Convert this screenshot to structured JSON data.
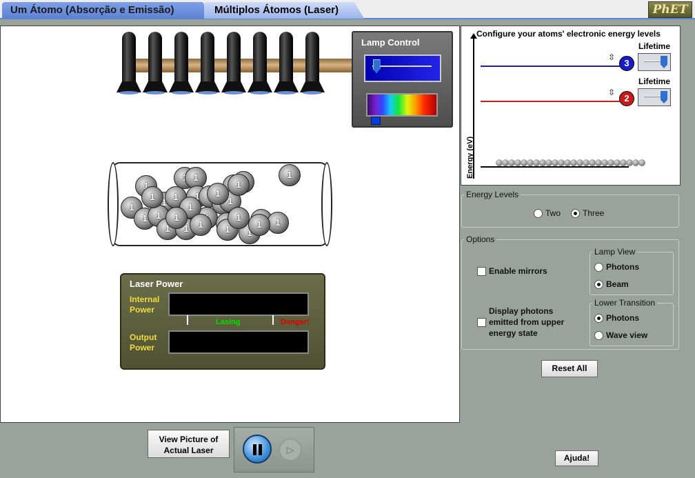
{
  "tabs": [
    {
      "label": "Um Átomo (Absorção e Emissão)",
      "active": false
    },
    {
      "label": "Múltiplos Átomos (Laser)",
      "active": true
    }
  ],
  "logo": "PhET",
  "lamp_control": {
    "title": "Lamp Control",
    "lamp_count": 8,
    "intensity_fraction": 0.05
  },
  "tube": {
    "atom_label": "1",
    "atom_count": 32
  },
  "laser_power": {
    "title": "Laser Power",
    "internal_label_1": "Internal",
    "internal_label_2": "Power",
    "lasing_label": "Lasing",
    "danger_label": "Danger!",
    "output_label_1": "Output",
    "output_label_2": "Power"
  },
  "energy_panel": {
    "header": "Configure your atoms' electronic energy levels",
    "y_axis_label": "Energy (eV)",
    "levels": [
      {
        "badge": "3",
        "lifetime_label": "Lifetime",
        "color": "#1a1ac8"
      },
      {
        "badge": "2",
        "lifetime_label": "Lifetime",
        "color": "#c81a1a"
      }
    ]
  },
  "energy_levels_group": {
    "title": "Energy Levels",
    "options": [
      {
        "label": "Two",
        "selected": false
      },
      {
        "label": "Three",
        "selected": true
      }
    ]
  },
  "options_group": {
    "title": "Options",
    "enable_mirrors": {
      "label": "Enable mirrors",
      "checked": false
    },
    "display_photons": {
      "label_lines": [
        "Display photons",
        "emitted from upper",
        "energy state"
      ],
      "checked": false
    },
    "lamp_view": {
      "title": "Lamp View",
      "options": [
        {
          "label": "Photons",
          "selected": false
        },
        {
          "label": "Beam",
          "selected": true
        }
      ]
    },
    "lower_transition": {
      "title": "Lower Transition",
      "options": [
        {
          "label": "Photons",
          "selected": true
        },
        {
          "label": "Wave view",
          "selected": false
        }
      ]
    }
  },
  "buttons": {
    "reset_all": "Reset All",
    "view_picture_1": "View Picture of",
    "view_picture_2": "Actual Laser",
    "help": "Ajuda!"
  },
  "colors": {
    "background": "#9aa39b",
    "level3": "#1a1ac8",
    "level2": "#c81a1a",
    "lasing": "#00e000",
    "danger": "#e00000"
  }
}
